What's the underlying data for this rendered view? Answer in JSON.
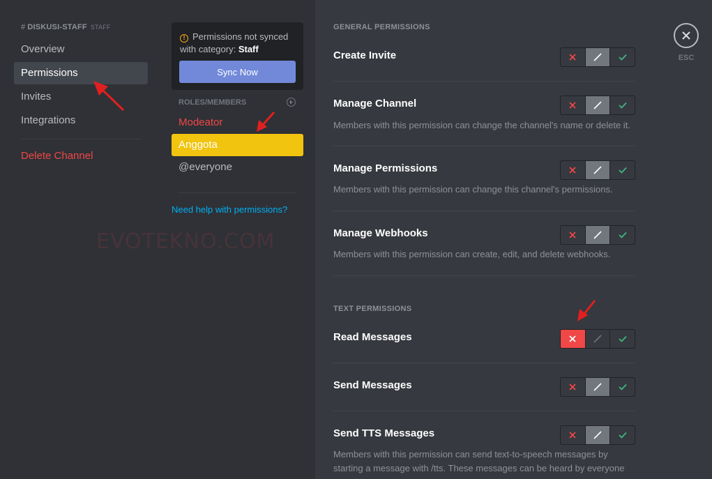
{
  "nav": {
    "channel_name": "DISKUSI-STAFF",
    "category": "STAFF",
    "items": [
      {
        "label": "Overview",
        "active": false
      },
      {
        "label": "Permissions",
        "active": true
      },
      {
        "label": "Invites",
        "active": false
      },
      {
        "label": "Integrations",
        "active": false
      }
    ],
    "delete_label": "Delete Channel"
  },
  "roles": {
    "notice_text": "Permissions not synced with category:",
    "notice_category": "Staff",
    "sync_button": "Sync Now",
    "header": "ROLES/MEMBERS",
    "items": [
      {
        "label": "Modeator",
        "color": "#f04747",
        "selected": false
      },
      {
        "label": "Anggota",
        "color": "#f1c40f",
        "selected": true
      },
      {
        "label": "@everyone",
        "color": "#b9bbbe",
        "selected": false
      }
    ],
    "help_link": "Need help with permissions?"
  },
  "main": {
    "general_title": "GENERAL PERMISSIONS",
    "text_title": "TEXT PERMISSIONS",
    "permissions": [
      {
        "name": "Create Invite",
        "description": "",
        "state": "neutral"
      },
      {
        "name": "Manage Channel",
        "description": "Members with this permission can change the channel's name or delete it.",
        "state": "neutral"
      },
      {
        "name": "Manage Permissions",
        "description": "Members with this permission can change this channel's permissions.",
        "state": "neutral"
      },
      {
        "name": "Manage Webhooks",
        "description": "Members with this permission can create, edit, and delete webhooks.",
        "state": "neutral"
      },
      {
        "name": "Read Messages",
        "description": "",
        "state": "deny"
      },
      {
        "name": "Send Messages",
        "description": "",
        "state": "neutral"
      },
      {
        "name": "Send TTS Messages",
        "description": "Members with this permission can send text-to-speech messages by starting a message with /tts. These messages can be heard by everyone",
        "state": "neutral"
      }
    ]
  },
  "close": {
    "label": "ESC"
  },
  "watermark": "EVOTEKNO.COM",
  "colors": {
    "accent": "#7289da",
    "deny": "#f04747",
    "allow": "#43b581",
    "role_selected": "#f1c40f"
  }
}
